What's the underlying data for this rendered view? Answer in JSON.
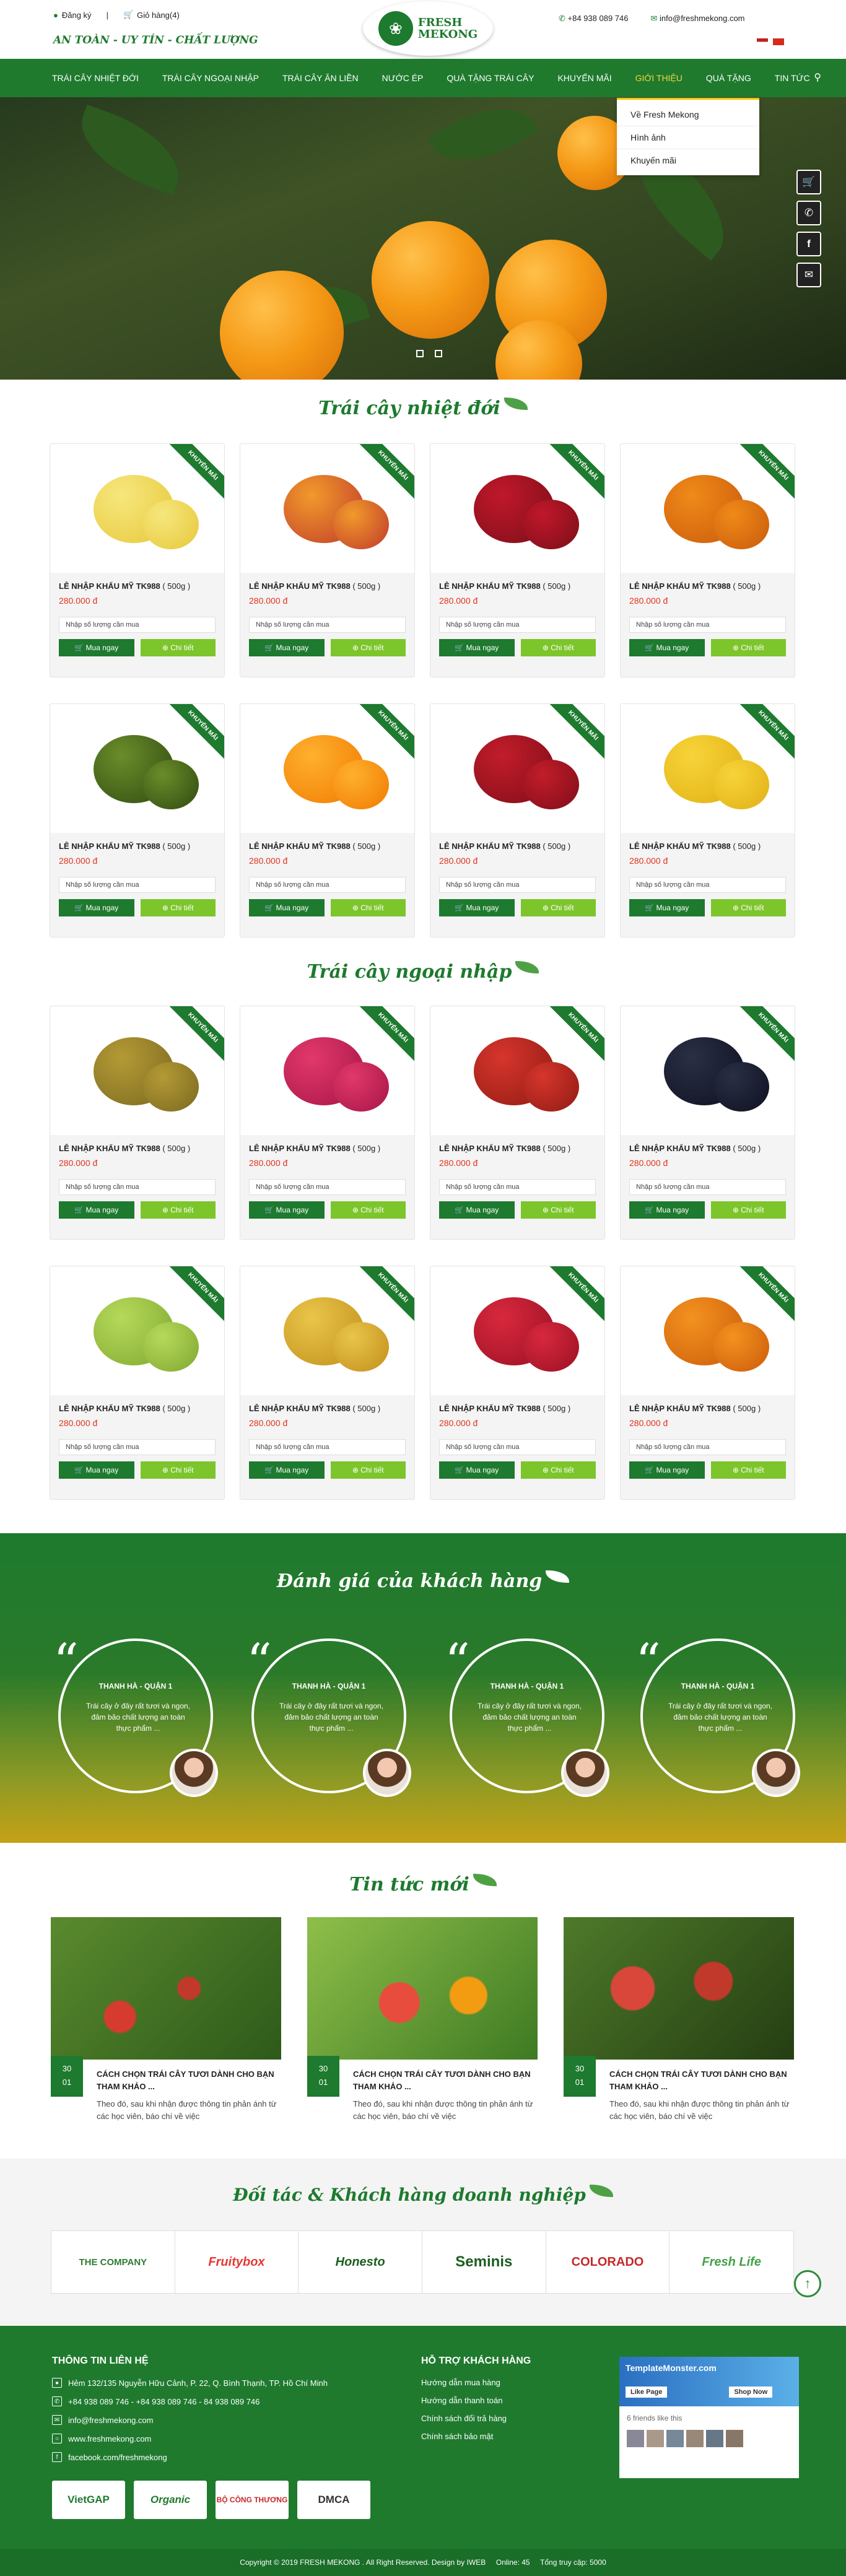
{
  "header": {
    "login": "Đăng ký",
    "separator": "|",
    "cart": "Giỏ hàng(4)",
    "slogan": "AN TOÀN - UY TÍN - CHẤT LƯỢNG",
    "logo_line1": "FRESH",
    "logo_line2": "MEKONG",
    "phone": "+84 938 089 746",
    "email": "info@freshmekong.com"
  },
  "nav": {
    "items": [
      "TRÁI CÂY NHIỆT ĐỚI",
      "TRÁI CÂY NGOẠI NHẬP",
      "TRÁI CÂY ĂN LIỀN",
      "NƯỚC ÉP",
      "QUÀ TẶNG TRÁI CÂY",
      "KHUYẾN MÃI",
      "GIỚI THIỆU",
      "QUÀ TẶNG",
      "TIN TỨC"
    ],
    "active_index": 6,
    "dropdown": [
      "Về Fresh Mekong",
      "Hình ảnh",
      "Khuyến mãi"
    ]
  },
  "sections": {
    "tropical": "Trái cây nhiệt đới",
    "imported": "Trái cây ngoại nhập",
    "reviews": "Đánh giá của khách hàng",
    "news": "Tin tức mới",
    "partners": "Đối tác & Khách hàng doanh nghiệp"
  },
  "product": {
    "ribbon": "KHUYẾN MÃI",
    "name": "LÊ NHẬP KHẨU MỸ TK988",
    "weight": "( 500g )",
    "price": "280.000 đ",
    "qty_placeholder": "Nhập số lượng cần mua",
    "buy": "Mua ngay",
    "detail": "Chi tiết"
  },
  "products_tropical": [
    "apple",
    "mango",
    "cranberry",
    "persimmon",
    "avocado",
    "orange",
    "pomegranate",
    "banana"
  ],
  "products_imported": [
    "durian",
    "dragonfruit",
    "rambutan",
    "acai",
    "guava",
    "pear",
    "lychee",
    "papaya"
  ],
  "testimonials": {
    "name": "THANH HÀ - QUẬN 1",
    "text": "Trái cây ở đây rất tươi và ngon, đảm bảo chất lượng an toàn thực phẩm ..."
  },
  "news": {
    "date_day": "30",
    "date_month": "01",
    "title": "CÁCH CHỌN TRÁI CÂY TƯƠI DÀNH CHO BẠN THAM KHẢO ...",
    "excerpt": "Theo đó, sau khi nhận được thông tin phản ánh từ các học viên, báo chí về việc"
  },
  "partners": [
    "THE COMPANY",
    "Fruitybox",
    "Honesto",
    "Seminis",
    "COLORADO",
    "Fresh Life"
  ],
  "footer": {
    "contact_title": "THÔNG TIN LIÊN HỆ",
    "address": "Hẻm 132/135 Nguyễn Hữu Cảnh, P. 22, Q. Bình Thạnh, TP. Hồ Chí Minh",
    "phones": "+84 938 089 746 - +84 938 089 746 - 84 938 089 746",
    "email": "info@freshmekong.com",
    "web": "www.freshmekong.com",
    "facebook": "facebook.com/freshmekong",
    "support_title": "HỖ TRỢ KHÁCH HÀNG",
    "support": [
      "Hướng dẫn mua hàng",
      "Hướng dẫn thanh toán",
      "Chính sách đổi trả hàng",
      "Chính sách bảo mật"
    ],
    "fb_name": "TemplateMonster.com",
    "fb_like": "Like Page",
    "fb_shop": "Shop Now",
    "fb_friends": "6 friends like this",
    "certs": [
      "VietGAP",
      "Organic",
      "BỘ CÔNG THƯƠNG",
      "DMCA"
    ],
    "copyright": "Copyright © 2019 FRESH MEKONG . All Right Reserved. Design by IWEB",
    "online": "Online: 45",
    "total": "Tổng truy cập: 5000"
  }
}
